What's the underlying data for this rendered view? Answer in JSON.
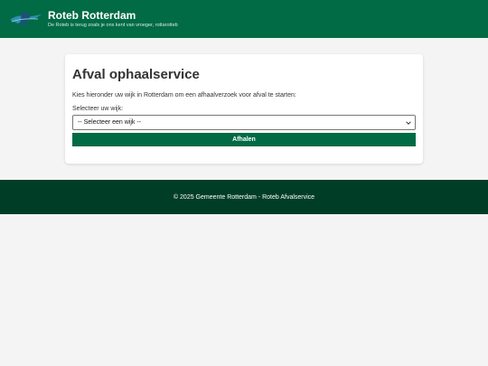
{
  "header": {
    "logo": "roteb-logo",
    "title": "Roteb Rotterdam",
    "subtitle": "De Roteb is terug zoals je ons kent van vroeger, rottarotteb"
  },
  "main": {
    "title": "Afval ophaalservice",
    "intro": "Kies hieronder uw wijk in Rotterdam om een afhaalverzoek voor afval te starten:",
    "select_label": "Selecteer uw wijk:",
    "select_value": "-- Selecteer een wijk --",
    "button_label": "Afhalen"
  },
  "footer": {
    "text": "© 2025 Gemeente Rotterdam - Roteb Afvalservice"
  },
  "colors": {
    "brand_green": "#006b45",
    "footer_green": "#003d27",
    "background": "#f4f4f4"
  }
}
